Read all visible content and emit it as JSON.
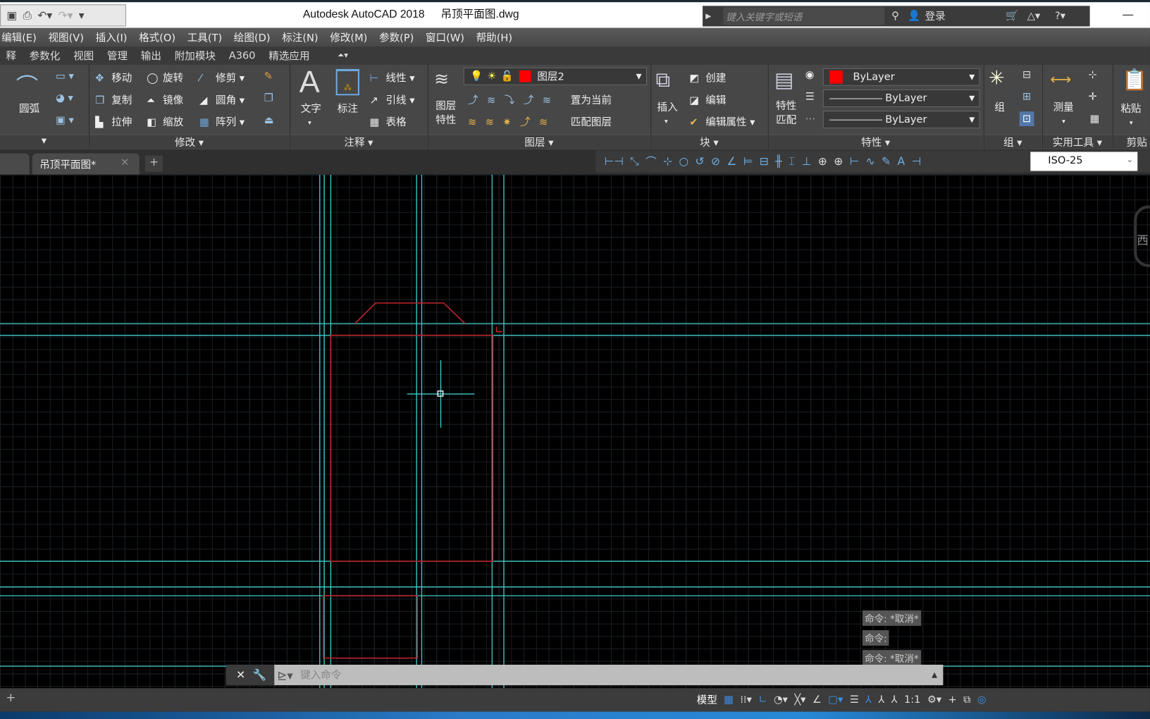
{
  "window": {
    "app": "Autodesk AutoCAD 2018",
    "file": "吊顶平面图.dwg"
  },
  "search": {
    "placeholder": "键入关键字或短语",
    "login": "登录"
  },
  "menu": [
    "编辑(E)",
    "视图(V)",
    "插入(I)",
    "格式(O)",
    "工具(T)",
    "绘图(D)",
    "标注(N)",
    "修改(M)",
    "参数(P)",
    "窗口(W)",
    "帮助(H)"
  ],
  "ribbon_tabs": [
    "释",
    "参数化",
    "视图",
    "管理",
    "输出",
    "附加模块",
    "A360",
    "精选应用"
  ],
  "ribbon": {
    "draw": {
      "arc": "圆弧"
    },
    "modify": {
      "title": "修改",
      "move": "移动",
      "rotate": "旋转",
      "trim": "修剪",
      "copy": "复制",
      "mirror": "镜像",
      "fillet": "圆角",
      "stretch": "拉伸",
      "scale": "缩放",
      "array": "阵列"
    },
    "annotation": {
      "title": "注释",
      "text": "文字",
      "dim": "标注",
      "linear": "线性",
      "leader": "引线",
      "table": "表格"
    },
    "layers": {
      "title": "图层",
      "props1": "图层",
      "props2": "特性",
      "current_layer": "图层2",
      "set_current": "置为当前",
      "match": "匹配图层"
    },
    "block": {
      "title": "块",
      "insert": "插入",
      "create": "创建",
      "edit": "编辑",
      "edit_attr": "编辑属性"
    },
    "properties": {
      "title": "特性",
      "match1": "特性",
      "match2": "匹配",
      "color": "ByLayer",
      "linetype": "ByLayer",
      "lineweight": "ByLayer"
    },
    "groups": {
      "title": "组",
      "group": "组"
    },
    "utilities": {
      "title": "实用工具",
      "measure": "测量"
    },
    "clipboard": {
      "title": "剪贴",
      "paste": "粘贴"
    }
  },
  "colors": {
    "layer_color": "#ff0000",
    "drawing_line": "#3fc9c9",
    "drawing_red": "#c0262b"
  },
  "document_tab": "吊顶平面图*",
  "dim_style": "ISO-25",
  "viewcube_label": "西",
  "command_history": [
    "命令: *取消*",
    "命令:",
    "命令: *取消*"
  ],
  "command": {
    "placeholder": "键入命令"
  },
  "status": {
    "model": "模型",
    "scale": "1:1"
  }
}
